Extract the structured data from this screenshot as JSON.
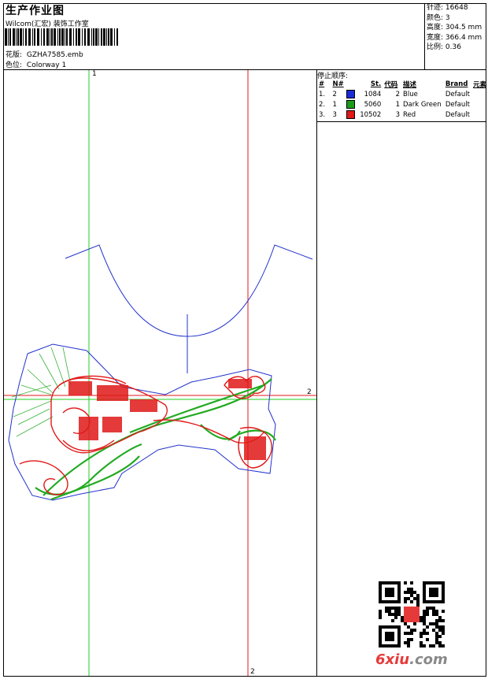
{
  "header": {
    "title": "生产作业图",
    "company": "Wilcom(汇宏) 装饰工作室",
    "design_label": "花版:",
    "design_value": "GZHA7585.emb",
    "colorway_label": "色位:",
    "colorway_value": "Colorway 1"
  },
  "stats": [
    {
      "label": "针迹:",
      "value": "16648"
    },
    {
      "label": "颜色:",
      "value": "3"
    },
    {
      "label": "高度:",
      "value": "304.5 mm"
    },
    {
      "label": "宽度:",
      "value": "366.4 mm"
    },
    {
      "label": "比例:",
      "value": "0.36"
    }
  ],
  "stop_sequence": {
    "title": "停止顺序:",
    "columns": [
      "#",
      "N#",
      "St.",
      "代码",
      "描述",
      "Brand",
      "元素"
    ],
    "rows": [
      {
        "idx": "1.",
        "n": "2",
        "color": "#1a2bd8",
        "st": "1084",
        "code": "2",
        "desc": "Blue",
        "brand": "Default"
      },
      {
        "idx": "2.",
        "n": "1",
        "color": "#1a9c1a",
        "st": "5060",
        "code": "1",
        "desc": "Dark Green",
        "brand": "Default"
      },
      {
        "idx": "3.",
        "n": "3",
        "color": "#e01818",
        "st": "10502",
        "code": "3",
        "desc": "Red",
        "brand": "Default"
      }
    ]
  },
  "axes": {
    "green_label": "1",
    "red_label_right": "2",
    "red_label_bottom": "2"
  },
  "colors": {
    "blue": "#2233cc",
    "green": "#22aa22",
    "red": "#e01818"
  },
  "watermark": {
    "text_a": "6xiu",
    "text_b": ".com"
  }
}
